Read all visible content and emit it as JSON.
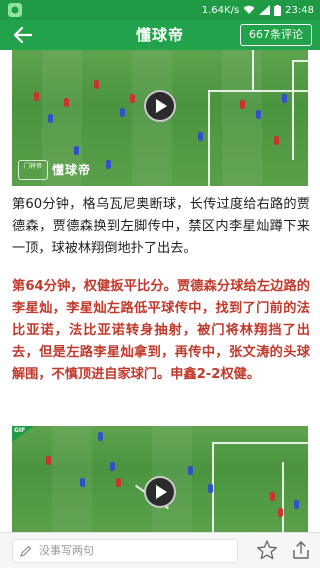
{
  "status_bar": {
    "network_speed": "1.64K/s",
    "time": "23:48"
  },
  "app_bar": {
    "title": "懂球帝",
    "comments_label": "667条评论"
  },
  "video1": {
    "watermark_text": "懂球帝",
    "watermark_logo": "门将帝"
  },
  "article": {
    "paragraph1": "第60分钟，格乌瓦尼奥断球，长传过度给右路的贾德森，贾德森换到左脚传中，禁区内李星灿蹲下来一顶，球被林翔倒地扑了出去。",
    "paragraph2": "第64分钟，权健扳平比分。贾德森分球给左边路的李星灿，李星灿左路低平球传中，找到了门前的法比亚诺，法比亚诺转身抽射，被门将林翔挡了出去，但是左路李星灿拿到，再传中，张文涛的头球解围，不慎顶进自家球门。申鑫2-2权健。"
  },
  "video2": {
    "badge": "GIF"
  },
  "bottom_bar": {
    "comment_placeholder": "没事写两句"
  },
  "colors": {
    "brand_green": "#22a24a",
    "highlight_red": "#c0392b"
  },
  "icons": {
    "back": "arrow-left-icon",
    "pencil": "pencil-icon",
    "favorite": "star-icon",
    "share": "share-icon",
    "play": "play-icon"
  }
}
